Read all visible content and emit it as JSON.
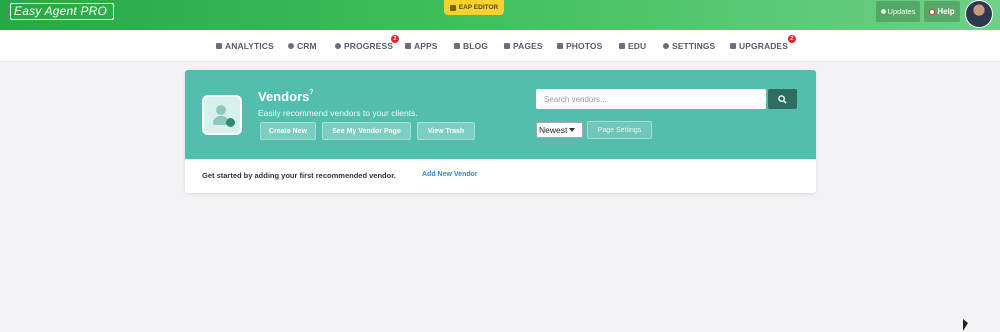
{
  "topbar": {
    "logo_text": "Easy Agent PRO",
    "eap_editor_label": "EAP EDITOR",
    "updates_label": "Updates",
    "help_label": "Help"
  },
  "nav": {
    "items": [
      {
        "label": "ANALYTICS",
        "icon": "analytics-icon"
      },
      {
        "label": "CRM",
        "icon": "crm-icon"
      },
      {
        "label": "PROGRESS",
        "icon": "progress-icon",
        "badge": "2"
      },
      {
        "label": "APPS",
        "icon": "apps-icon"
      },
      {
        "label": "BLOG",
        "icon": "blog-icon"
      },
      {
        "label": "PAGES",
        "icon": "pages-icon"
      },
      {
        "label": "PHOTOS",
        "icon": "photos-icon"
      },
      {
        "label": "EDU",
        "icon": "edu-icon"
      },
      {
        "label": "SETTINGS",
        "icon": "gear-icon"
      },
      {
        "label": "UPGRADES",
        "icon": "upgrades-icon",
        "badge": "2"
      }
    ]
  },
  "vendors": {
    "title": "Vendors",
    "help_icon": "?",
    "subtitle": "Easily recommend vendors to your clients.",
    "buttons": {
      "create_new": "Create New",
      "see_vendor_page": "See My Vendor Page",
      "view_trash": "View Trash",
      "page_settings": "Page Settings"
    },
    "search": {
      "placeholder": "Search vendors...",
      "value": ""
    },
    "sort_select": {
      "selected": "Newest"
    },
    "empty_message": "Get started by adding your first recommended vendor.",
    "add_link": "Add New Vendor"
  },
  "colors": {
    "topbar_green": "#3fbf5a",
    "teal_header": "#53bdae",
    "search_button": "#2f6d63",
    "badge_red": "#e4262c",
    "eap_yellow": "#f6d22e",
    "link_blue": "#3a84c8"
  }
}
